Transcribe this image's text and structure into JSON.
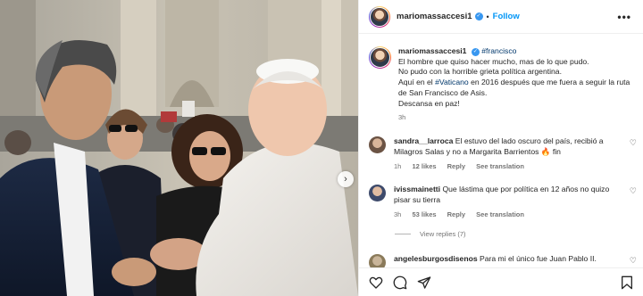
{
  "header": {
    "username": "mariomassaccesi1",
    "follow_label": "Follow",
    "separator": "•",
    "more_label": "•••"
  },
  "caption": {
    "username": "mariomassaccesi1",
    "hashtag": "#francisco",
    "line1": "El hombre que quiso hacer mucho, mas de lo que pudo.",
    "line2": "No pudo con la horrible grieta política argentina.",
    "line3_pre": "Aquí en el ",
    "line3_tag": "#Vaticano",
    "line3_post": " en 2016 después que me fuera a seguir la ruta de San Francisco de Asis.",
    "line4": "Descansa en paz!",
    "time": "3h"
  },
  "comments": [
    {
      "username": "sandra__larroca",
      "text": "El estuvo del lado oscuro del país, recibió a Milagros Salas y no a Margarita Barrientos 🔥 fin",
      "time": "1h",
      "likes": "12 likes",
      "reply": "Reply",
      "translate": "See translation"
    },
    {
      "username": "ivissmainetti",
      "text": "Que lástima que por política en 12 años no quizo pisar su tierra",
      "time": "3h",
      "likes": "53 likes",
      "reply": "Reply",
      "translate": "See translation"
    },
    {
      "username": "angelesburgosdisenos",
      "text": "Para mi el único fue Juan Pablo II."
    }
  ],
  "view_replies": "View replies (7)",
  "icons": {
    "verified": "verified-badge-icon",
    "like": "heart-icon",
    "comment": "comment-icon",
    "share": "share-icon",
    "save": "bookmark-icon",
    "next": "chevron-right-icon"
  },
  "colors": {
    "link": "#0095f6",
    "hashtag": "#00376b",
    "meta": "#737373"
  }
}
